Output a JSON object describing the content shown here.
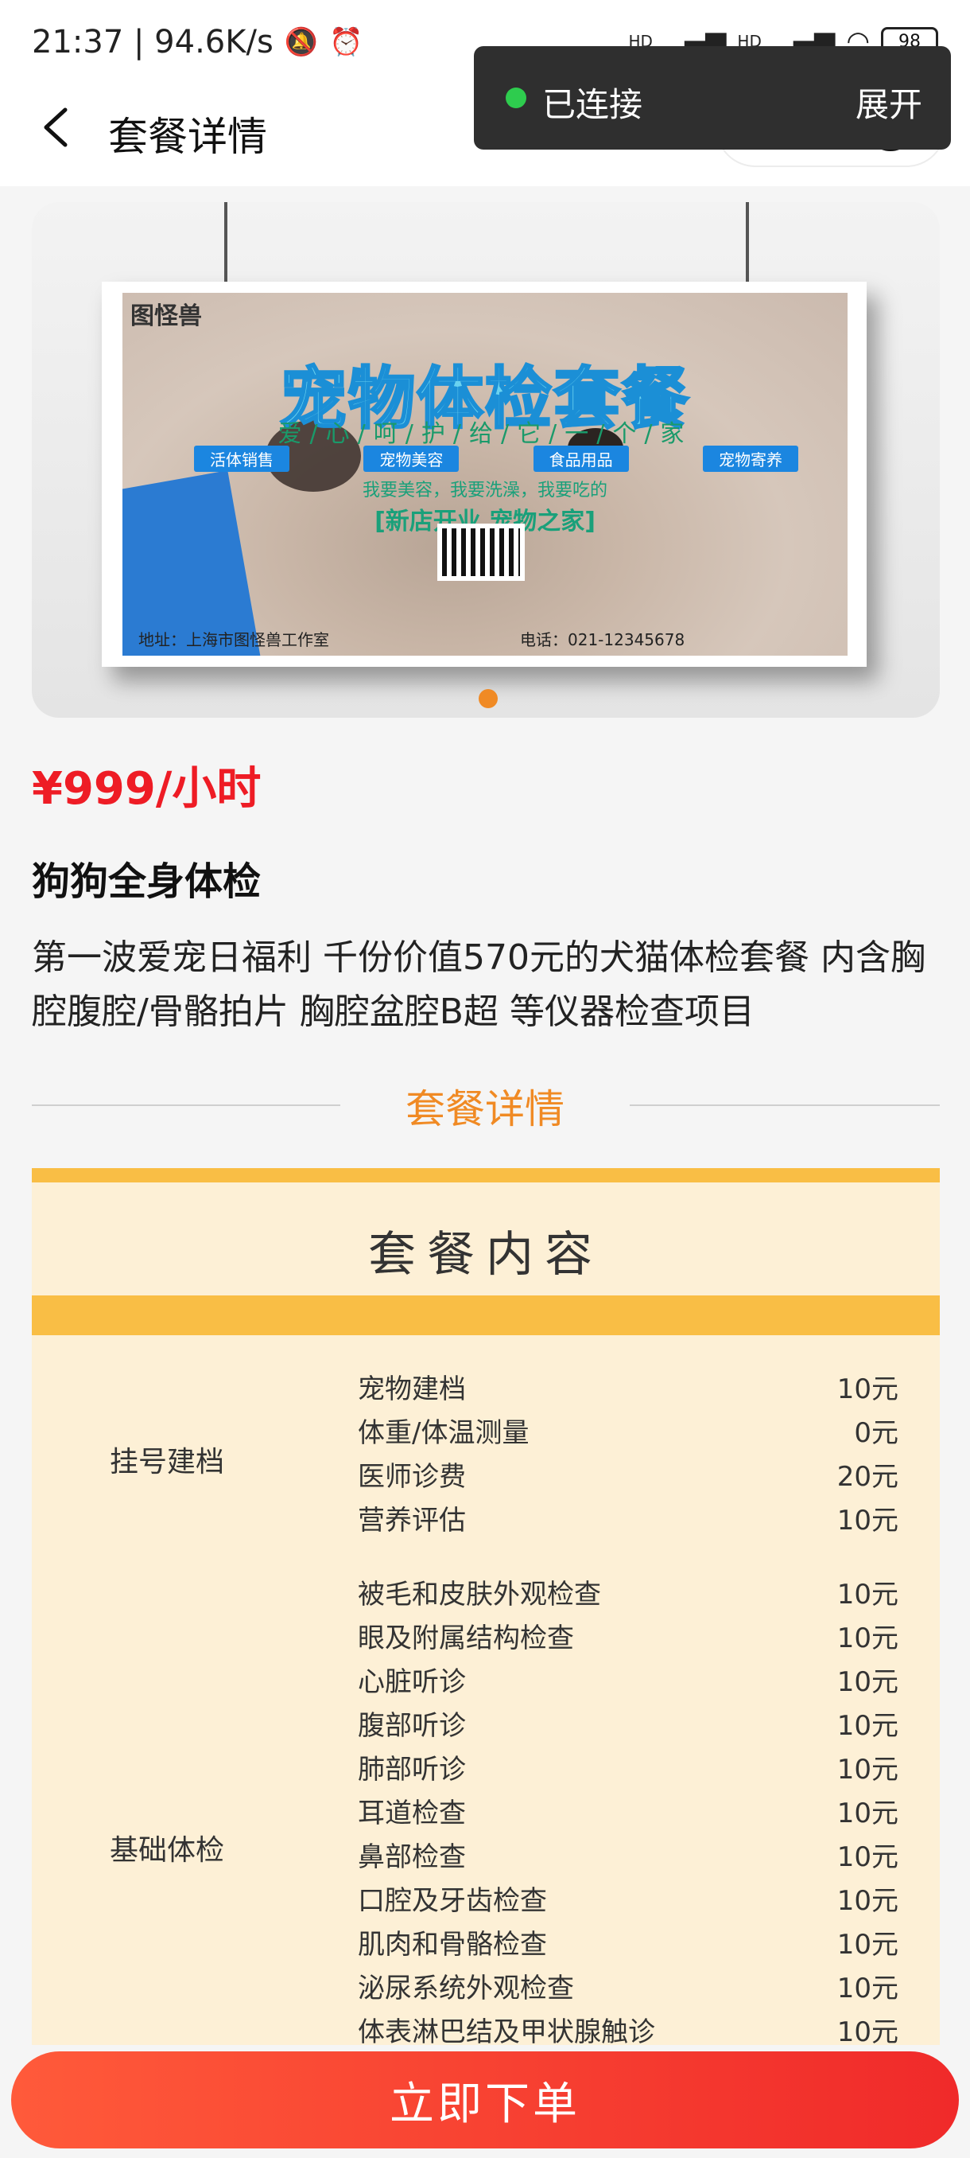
{
  "status_bar": {
    "time_speed": "21:37 | 94.6K/s",
    "battery": "98",
    "signal_1": "HD",
    "signal_2": "HD"
  },
  "header": {
    "title": "套餐详情"
  },
  "connection_toast": {
    "status": "已连接",
    "expand_label": "展开"
  },
  "banner": {
    "poster_logo": "图怪兽",
    "poster_title": "宠物体检套餐",
    "poster_subtitle": "爱/心/呵/护/给/它/一/个/家",
    "poster_tags": [
      "活体销售",
      "宠物美容",
      "食品用品",
      "宠物寄养"
    ],
    "poster_slogan": "我要美容，我要洗澡，我要吃的",
    "poster_opening": "[新店开业 宠物之家]",
    "poster_address": "地址：上海市图怪兽工作室",
    "poster_phone": "电话：021-12345678"
  },
  "product": {
    "price": "¥999/小时",
    "name": "狗狗全身体检",
    "description": "第一波爱宠日福利 千份价值570元的犬猫体检套餐 内含胸腔腹腔/骨骼拍片 胸腔盆腔B超 等仪器检查项目"
  },
  "section": {
    "divider_title": "套餐详情"
  },
  "package": {
    "title": "套餐内容",
    "groups": [
      {
        "label": "挂号建档",
        "items": [
          {
            "name": "宠物建档",
            "price": "10元"
          },
          {
            "name": "体重/体温测量",
            "price": "0元"
          },
          {
            "name": "医师诊费",
            "price": "20元"
          },
          {
            "name": "营养评估",
            "price": "10元"
          }
        ]
      },
      {
        "label": "基础体检",
        "items": [
          {
            "name": "被毛和皮肤外观检查",
            "price": "10元"
          },
          {
            "name": "眼及附属结构检查",
            "price": "10元"
          },
          {
            "name": "心脏听诊",
            "price": "10元"
          },
          {
            "name": "腹部听诊",
            "price": "10元"
          },
          {
            "name": "肺部听诊",
            "price": "10元"
          },
          {
            "name": "耳道检查",
            "price": "10元"
          },
          {
            "name": "鼻部检查",
            "price": "10元"
          },
          {
            "name": "口腔及牙齿检查",
            "price": "10元"
          },
          {
            "name": "肌肉和骨骼检查",
            "price": "10元"
          },
          {
            "name": "泌尿系统外观检查",
            "price": "10元"
          },
          {
            "name": "体表淋巴结及甲状腺触诊",
            "price": "10元"
          }
        ]
      }
    ]
  },
  "actions": {
    "order_button": "立即下单"
  }
}
